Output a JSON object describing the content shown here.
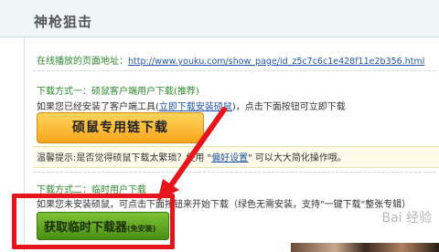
{
  "header": {
    "title": "神枪狙击"
  },
  "play_url": {
    "label": "在线播放的页面地址：",
    "url": "http://www.youku.com/show_page/id_z5c7c6c1e428f11e2b356.html"
  },
  "method1": {
    "title": "下载方式一：硕鼠客户端用户下载(推荐)",
    "desc_prefix": "如果您已经安装了客户端工具(",
    "desc_link": "立即下载安装硕鼠",
    "desc_suffix": ")，点击下面按钮可立即下载",
    "button_label": "硕鼠专用链下载"
  },
  "tip": {
    "prefix": "温馨提示:是否觉得硕鼠下载太繁琐？使用 \"",
    "link": "偏好设置",
    "suffix": "\" 可以大大简化操作哦。"
  },
  "method2": {
    "title": "下载方式二：临时用户下载",
    "desc": "如果您未安装硕鼠，可点击下面按钮来开始下载（绿色无需安装，支持\"一键下载\"整张专辑）",
    "button_label": "获取临时下载器",
    "button_sub": "(免安装)"
  },
  "watermark": "Bai 经验",
  "colors": {
    "highlight": "#e8141c",
    "accent_green": "#2f8a2f",
    "link": "#2255aa",
    "button_yellow": "#f7a51c",
    "button_green": "#4a8f12"
  }
}
